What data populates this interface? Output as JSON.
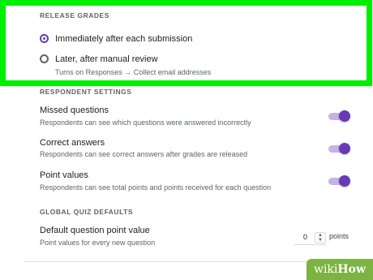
{
  "release_grades": {
    "title": "RELEASE GRADES",
    "options": [
      {
        "label": "Immediately after each submission",
        "checked": true
      },
      {
        "label": "Later, after manual review",
        "sub": "Turns on Responses → Collect email addresses",
        "checked": false
      }
    ]
  },
  "respondent_settings": {
    "title": "RESPONDENT SETTINGS",
    "items": [
      {
        "label": "Missed questions",
        "desc": "Respondents can see which questions were answered incorrectly",
        "on": true
      },
      {
        "label": "Correct answers",
        "desc": "Respondents can see correct answers after grades are released",
        "on": true
      },
      {
        "label": "Point values",
        "desc": "Respondents can see total points and points received for each question",
        "on": true
      }
    ]
  },
  "global_quiz_defaults": {
    "title": "GLOBAL QUIZ DEFAULTS",
    "default_points": {
      "label": "Default question point value",
      "desc": "Point values for every new question",
      "value": "0",
      "unit": "points"
    }
  },
  "watermark": {
    "wiki": "wiki",
    "how": "How"
  },
  "colors": {
    "accent": "#673ab7",
    "highlight_frame": "#00ee00",
    "watermark_bg": "#7cb342"
  }
}
